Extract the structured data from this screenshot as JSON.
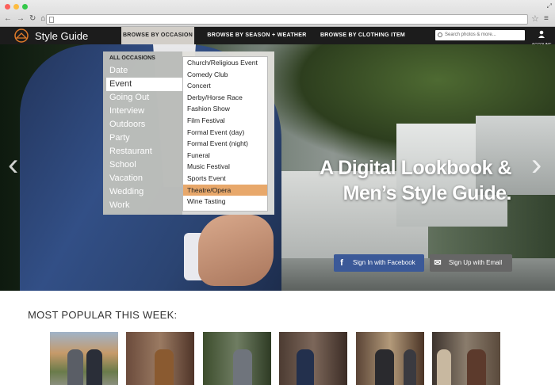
{
  "site": {
    "name": "Style Guide",
    "nav": {
      "tabs": [
        "BROWSE BY OCCASION",
        "BROWSE BY SEASON + WEATHER",
        "BROWSE BY CLOTHING ITEM"
      ],
      "search_placeholder": "Search photos & more...",
      "account_label": "ACCOUNT"
    }
  },
  "dropdown": {
    "heading": "ALL OCCASIONS",
    "occasions": [
      "Date",
      "Event",
      "Going Out",
      "Interview",
      "Outdoors",
      "Party",
      "Restaurant",
      "School",
      "Vacation",
      "Wedding",
      "Work"
    ],
    "selected_occasion": "Event",
    "events": [
      "Church/Religious Event",
      "Comedy Club",
      "Concert",
      "Derby/Horse Race",
      "Fashion Show",
      "Film Festival",
      "Formal Event (day)",
      "Formal Event (night)",
      "Funeral",
      "Music Festival",
      "Sports Event",
      "Theatre/Opera",
      "Wine Tasting"
    ],
    "selected_event": "Theatre/Opera",
    "highlight_color": "#e8a86b"
  },
  "hero": {
    "headline_line1": "A Digital Lookbook &",
    "headline_line2": "Men’s Style Guide.",
    "facebook_button": "Sign In with Facebook",
    "email_button": "Sign Up with Email"
  },
  "popular": {
    "title": "MOST POPULAR THIS WEEK:"
  },
  "colors": {
    "nav_bg": "#1c1c1c",
    "logo_accent": "#e07b2a",
    "facebook": "#3b5998"
  }
}
